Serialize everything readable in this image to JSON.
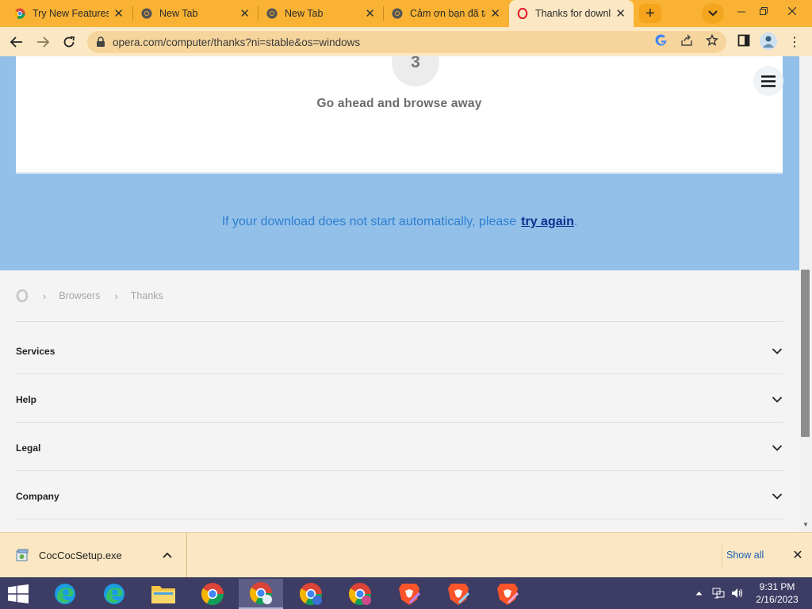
{
  "browser": {
    "tabs": [
      {
        "title": "Try New Features",
        "icon": "chrome-icon"
      },
      {
        "title": "New Tab",
        "icon": "chrome-icon"
      },
      {
        "title": "New Tab",
        "icon": "chrome-icon"
      },
      {
        "title": "Cảm ơn bạn đã tải",
        "icon": "coccoc-icon"
      },
      {
        "title": "Thanks for download",
        "icon": "opera-icon",
        "active": true
      }
    ],
    "close_glyph": "✕",
    "new_tab_glyph": "+",
    "address_url": "opera.com/computer/thanks?ni=stable&os=windows",
    "menu_glyph": "⋮"
  },
  "page": {
    "countdown": "3",
    "browse_away": "Go ahead and browse away",
    "download_msg_prefix": "If your download does not start automatically, please",
    "try_again": "try again",
    "download_msg_suffix": ".",
    "breadcrumb": [
      "Browsers",
      "Thanks"
    ],
    "footer_sections": [
      "Services",
      "Help",
      "Legal",
      "Company"
    ]
  },
  "download_shelf": {
    "filename": "CocCocSetup.exe",
    "show_all": "Show all",
    "close_glyph": "✕"
  },
  "taskbar": {
    "time": "9:31 PM",
    "date": "2/16/2023"
  },
  "colors": {
    "tabbar": "#f9b233",
    "toolbar": "#fbe7c3",
    "hero": "#92c0e9",
    "link": "#0e2f8f",
    "taskbar": "#3c3c64"
  }
}
